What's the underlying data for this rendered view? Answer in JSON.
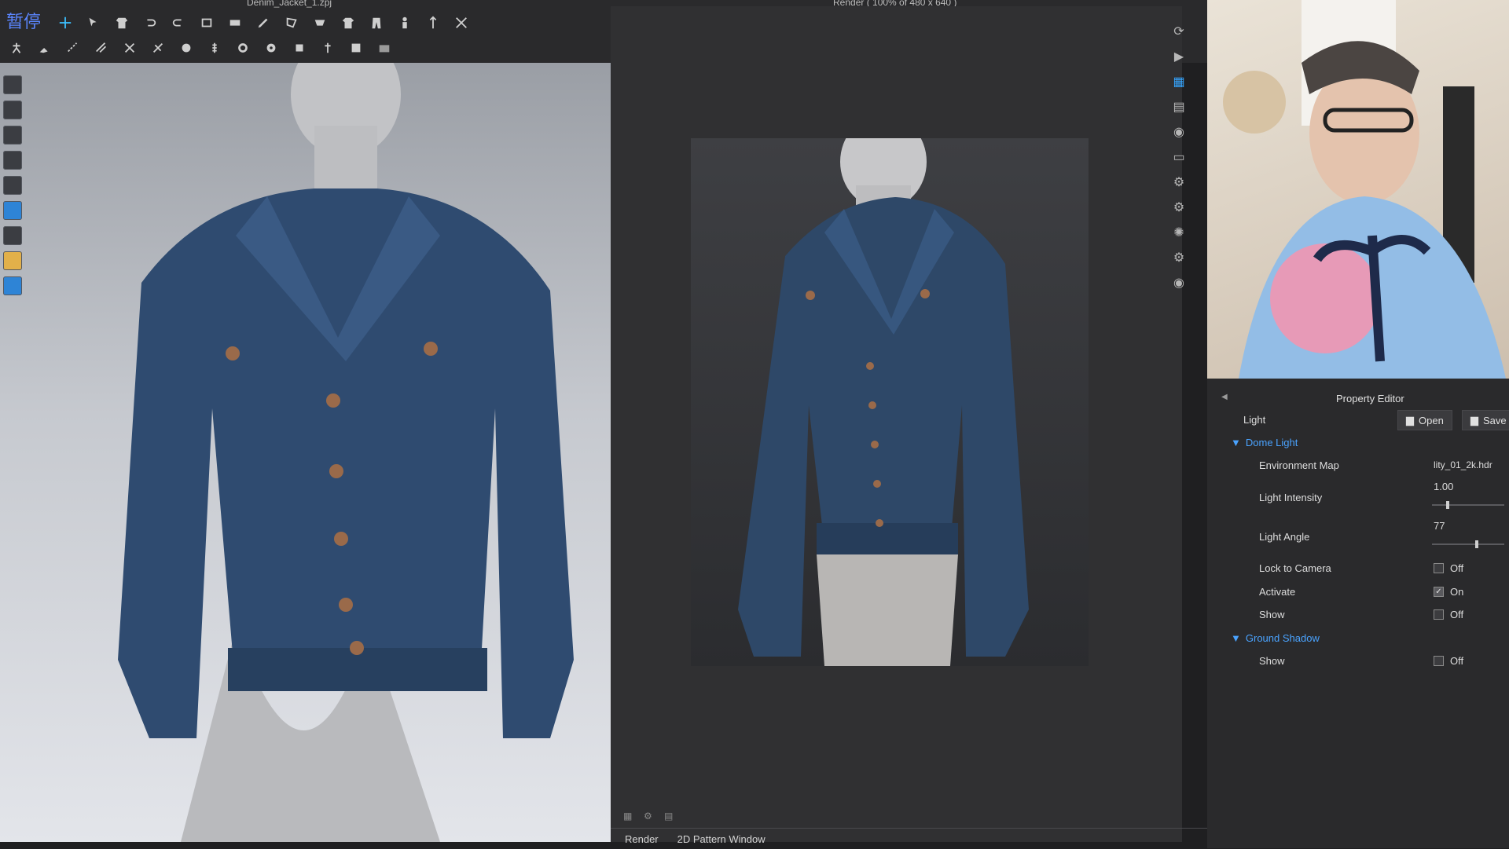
{
  "window": {
    "doc_title": "Denim_Jacket_1.zpj",
    "render_title": "Render ( 100% of 480 x 640 )",
    "paused_text": "暂停"
  },
  "icons": {
    "top_row1": [
      "move-icon",
      "select-icon",
      "garment-icon",
      "undo-icon",
      "redo-icon",
      "redo2-icon",
      "pattern-icon",
      "pencil-icon",
      "polygon-icon",
      "fold-icon",
      "shirt-icon",
      "pants-icon",
      "avatar-icon",
      "arrange-icon",
      "cut-icon"
    ],
    "top_row2": [
      "pose-icon",
      "brush-icon",
      "stitch-icon",
      "stitch2-icon",
      "scissor-icon",
      "tack-icon",
      "button-icon",
      "zipper-icon",
      "gear-icon",
      "target-icon",
      "puck-icon",
      "trim-icon",
      "texture-icon",
      "panel-icon"
    ],
    "left_tools": [
      "avatar-icon",
      "shirt-icon",
      "hanger-icon",
      "brush-icon",
      "figure-icon",
      "camera-icon",
      "steam-icon",
      "light-icon",
      "globe-icon"
    ],
    "right_tools": [
      "render-icon",
      "play-icon",
      "grid-icon",
      "layers-icon",
      "camera-icon",
      "video-icon",
      "camera-settings-icon",
      "camera-settings-icon",
      "light-settings-icon",
      "camera-settings-icon",
      "camera-icon"
    ]
  },
  "render_tabs": [
    "Render",
    "2D Pattern Window"
  ],
  "property_editor": {
    "title": "Property Editor",
    "object": "Light",
    "open_label": "Open",
    "save_label": "Save",
    "dome_light": {
      "section": "Dome Light",
      "environment_map_label": "Environment Map",
      "environment_map_value": "lity_01_2k.hdr",
      "light_intensity_label": "Light Intensity",
      "light_intensity_value": "1.00",
      "light_intensity_level": 0.2,
      "light_angle_label": "Light Angle",
      "light_angle_value": "77",
      "light_angle_level": 0.62,
      "lock_to_camera_label": "Lock to Camera",
      "lock_to_camera_value": "Off",
      "activate_label": "Activate",
      "activate_value": "On",
      "show_label": "Show",
      "show_value": "Off"
    },
    "ground_shadow": {
      "section": "Ground Shadow",
      "show_label": "Show",
      "show_value": "Off"
    }
  },
  "colors": {
    "accent": "#4aa3ff",
    "denim": "#2d4a6e",
    "mannequin": "#b9babd"
  }
}
